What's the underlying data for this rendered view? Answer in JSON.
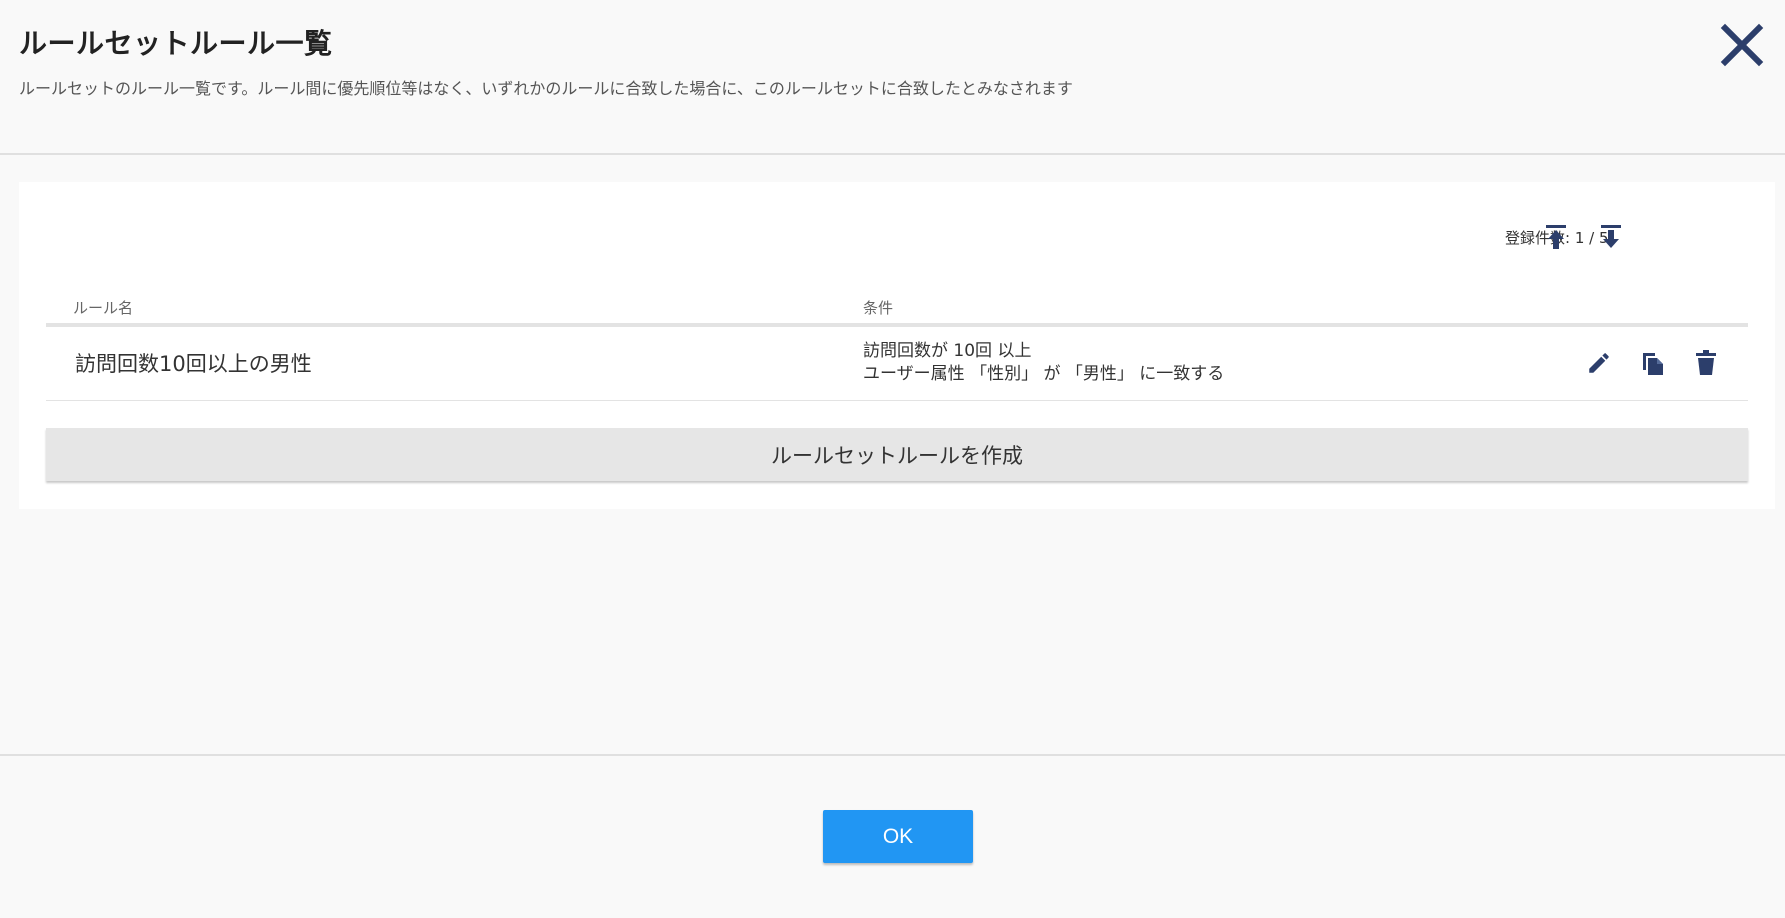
{
  "dialog": {
    "title": "ルールセットルール一覧",
    "description": "ルールセットのルール一覧です。ルール間に優先順位等はなく、いずれかのルールに合致した場合に、このルールセットに合致したとみなされます",
    "close_icon": "close-icon"
  },
  "list": {
    "count_label": "登録件数: 1 / 5",
    "export_icon": "upload-icon",
    "import_icon": "download-icon",
    "columns": {
      "name": "ルール名",
      "condition": "条件"
    },
    "rows": [
      {
        "name": "訪問回数10回以上の男性",
        "conditions": [
          "訪問回数が 10回 以上",
          "ユーザー属性 「性別」 が 「男性」 に一致する"
        ],
        "actions": [
          "edit-icon",
          "copy-icon",
          "trash-icon"
        ]
      }
    ],
    "create_label": "ルールセットルールを作成"
  },
  "footer": {
    "ok_label": "OK"
  },
  "colors": {
    "accent": "#2196f3",
    "icon": "#2c3e6b"
  }
}
